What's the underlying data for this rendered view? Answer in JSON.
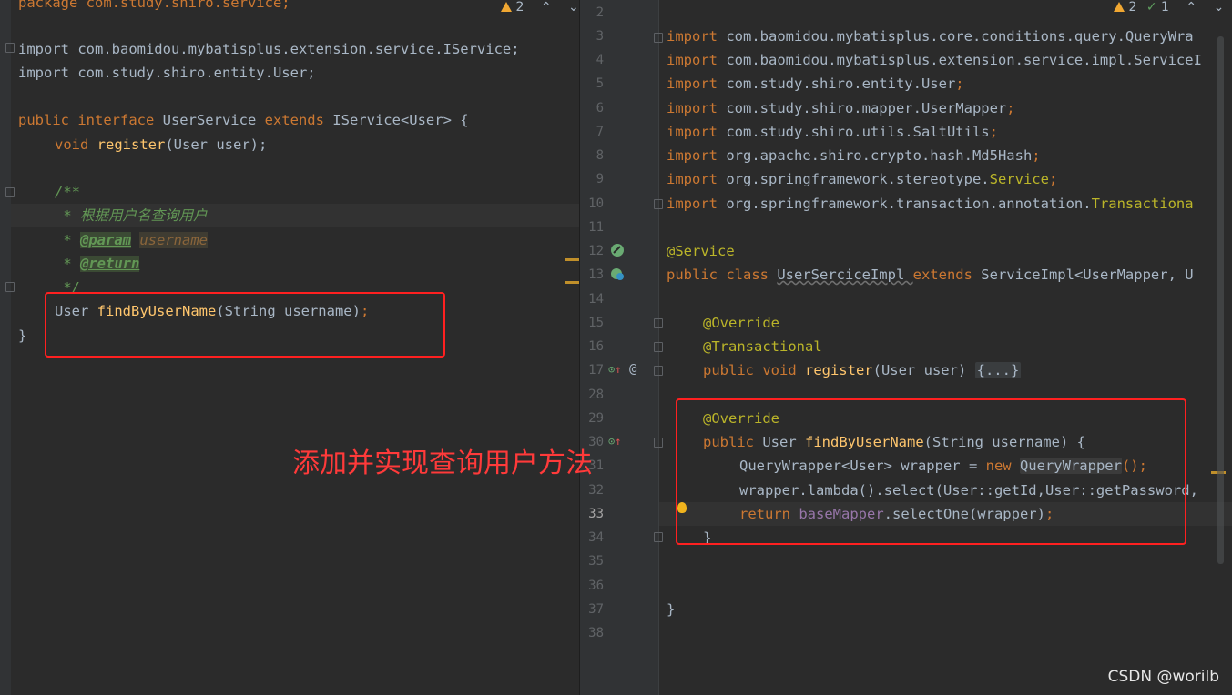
{
  "left": {
    "indicators": {
      "warnings": "2"
    },
    "code": {
      "l0": "package com.study.shiro.service;",
      "l1": "import com.baomidou.mybatisplus.extension.service.IService;",
      "l2": "import com.study.shiro.entity.User;",
      "iface_kw": "public interface ",
      "iface_name": "UserService ",
      "extends_kw": "extends ",
      "iface_tail": "IService<User> {",
      "void_kw": "void ",
      "register_fn": "register",
      "register_args": "(User user);",
      "doc_open": "/**",
      "doc_desc": " * 根据用户名查询用户",
      "doc_star1": " * ",
      "doc_param_tag": "@param",
      "doc_param_name": "username",
      "doc_star2": " * ",
      "doc_return_tag": "@return",
      "doc_close": " */",
      "find_ret": "User ",
      "find_fn": "findByUserName",
      "find_args": "(String username)",
      "find_end": ";",
      "close_brace": "}"
    }
  },
  "right": {
    "indicators": {
      "warnings": "2",
      "checks": "1"
    },
    "line_numbers": [
      "2",
      "3",
      "4",
      "5",
      "6",
      "7",
      "8",
      "9",
      "10",
      "11",
      "12",
      "13",
      "14",
      "15",
      "16",
      "17",
      "28",
      "29",
      "30",
      "31",
      "32",
      "33",
      "34",
      "35",
      "36",
      "37",
      "38"
    ],
    "current_line": "33",
    "code": {
      "import_kw": "import ",
      "imp3": "com.baomidou.mybatisplus.core.conditions.query.QueryWra",
      "imp4": "com.baomidou.mybatisplus.extension.service.impl.ServiceI",
      "imp5": "com.study.shiro.entity.User",
      "imp6": "com.study.shiro.mapper.UserMapper",
      "imp7": "com.study.shiro.utils.SaltUtils",
      "imp8": "org.apache.shiro.crypto.hash.Md5Hash",
      "imp9_pre": "org.springframework.stereotype.",
      "imp9_ann": "Service",
      "imp10_pre": "org.springframework.transaction.annotation.",
      "imp10_ann": "Transactiona",
      "semi": ";",
      "ann_service": "@Service",
      "class_kw": "public class ",
      "class_name": "UserSerciceImpl ",
      "class_ext": "extends ",
      "class_tail": "ServiceImpl<UserMapper, U",
      "ann_override": "@Override",
      "ann_transactional": "@Transactional",
      "pub_void": "public void ",
      "register_fn": "register",
      "register_args": "(User user) ",
      "fold_placeholder": "{...}",
      "ann_override2": "@Override",
      "pub_kw": "public ",
      "find_ret": "User ",
      "find_fn": "findByUserName",
      "find_args": "(String username) {",
      "qw_decl": "QueryWrapper<User> wrapper = ",
      "new_kw": "new ",
      "qw_ctor": "QueryWrapper",
      "qw_end": "();",
      "lambda_line": "wrapper.lambda().select(User::getId,User::getPassword,",
      "return_kw": "return ",
      "base_mapper": "baseMapper",
      "select_one": ".selectOne(wrapper)",
      "ret_semi": ";",
      "close_inner": "}",
      "close_outer": "}"
    }
  },
  "annotation_text": "添加并实现查询用户方法",
  "watermark": "CSDN @worilb",
  "colors": {
    "keyword": "#cc7832",
    "function": "#ffc66d",
    "annotation": "#bbb529",
    "comment": "#629755",
    "field": "#9876aa",
    "redbox": "#ff2020"
  }
}
